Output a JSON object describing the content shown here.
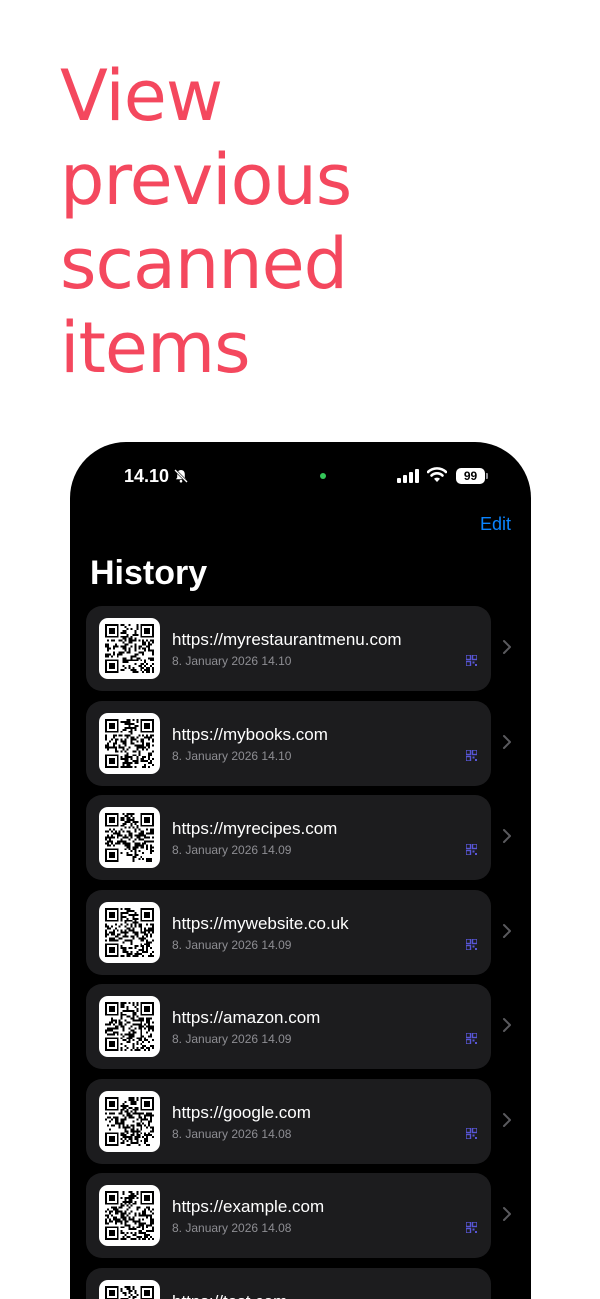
{
  "headline": [
    "View",
    "previous",
    "scanned",
    "items"
  ],
  "status_bar": {
    "time": "14.10",
    "battery": "99"
  },
  "nav": {
    "edit_label": "Edit",
    "title": "History"
  },
  "colors": {
    "accent": "#f4485e",
    "link": "#0a84ff",
    "row_bg": "#1c1c1e",
    "type_icon": "#5856d6"
  },
  "history": [
    {
      "url": "https://myrestaurantmenu.com",
      "date": "8. January 2026",
      "time": "14.10",
      "type_icon": "qr-code-icon"
    },
    {
      "url": "https://mybooks.com",
      "date": "8. January 2026",
      "time": "14.10",
      "type_icon": "qr-code-icon"
    },
    {
      "url": "https://myrecipes.com",
      "date": "8. January 2026",
      "time": "14.09",
      "type_icon": "qr-code-icon"
    },
    {
      "url": "https://mywebsite.co.uk",
      "date": "8. January 2026",
      "time": "14.09",
      "type_icon": "qr-code-icon"
    },
    {
      "url": "https://amazon.com",
      "date": "8. January 2026",
      "time": "14.09",
      "type_icon": "qr-code-icon"
    },
    {
      "url": "https://google.com",
      "date": "8. January 2026",
      "time": "14.08",
      "type_icon": "qr-code-icon"
    },
    {
      "url": "https://example.com",
      "date": "8. January 2026",
      "time": "14.08",
      "type_icon": "qr-code-icon"
    },
    {
      "url": "https://test.com",
      "date": "",
      "time": "",
      "type_icon": "qr-code-icon"
    }
  ]
}
